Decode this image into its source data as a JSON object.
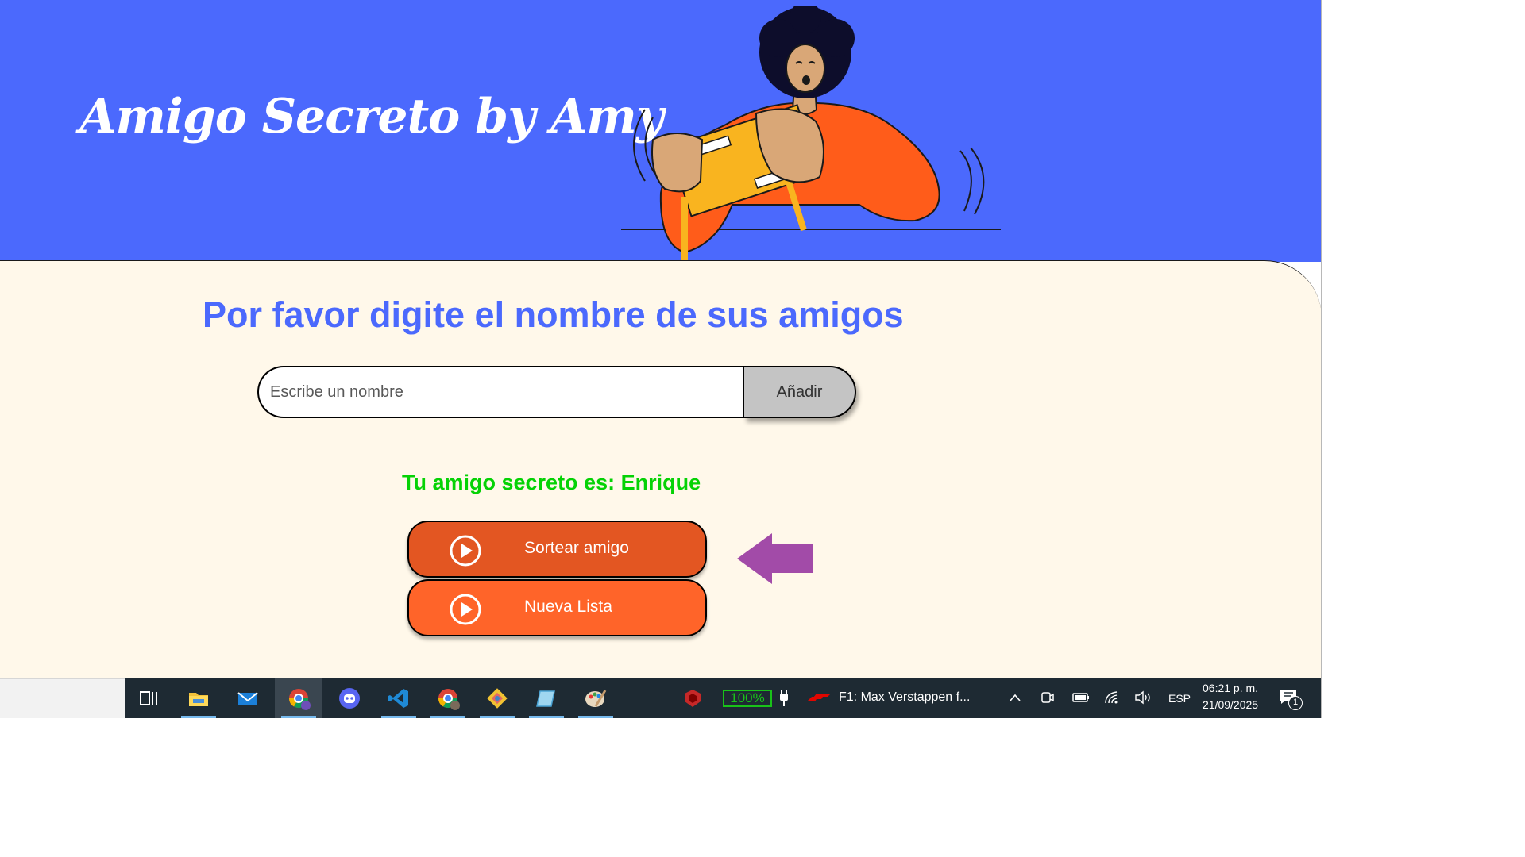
{
  "app": {
    "title": "Amigo Secreto by Amy",
    "section_title": "Por favor digite el nombre de sus amigos",
    "input": {
      "placeholder": "Escribe un nombre",
      "value": ""
    },
    "add_button": "Añadir",
    "result_text": "Tu amigo secreto es: Enrique",
    "buttons": {
      "draw": "Sortear amigo",
      "new_list": "Nueva Lista"
    },
    "colors": {
      "header_bg": "#4b69fd",
      "main_bg": "#fff8ea",
      "title_blue": "#4b69fd",
      "result_green": "#05d205",
      "button_orange": "#ff6429",
      "arrow_purple": "#a24ba8"
    }
  },
  "taskbar": {
    "apps": [
      "task-view-icon",
      "file-explorer-icon",
      "mail-icon",
      "chrome-profile-a-icon",
      "discord-icon",
      "vscode-icon",
      "chrome-profile-m-icon",
      "git-icon",
      "notes-icon",
      "paint-icon"
    ],
    "battery_percent": "100%",
    "now_playing": "F1: Max Verstappen f...",
    "language": "ESP",
    "time": "06:21 p. m.",
    "date": "21/09/2025",
    "notification_count": "1"
  }
}
